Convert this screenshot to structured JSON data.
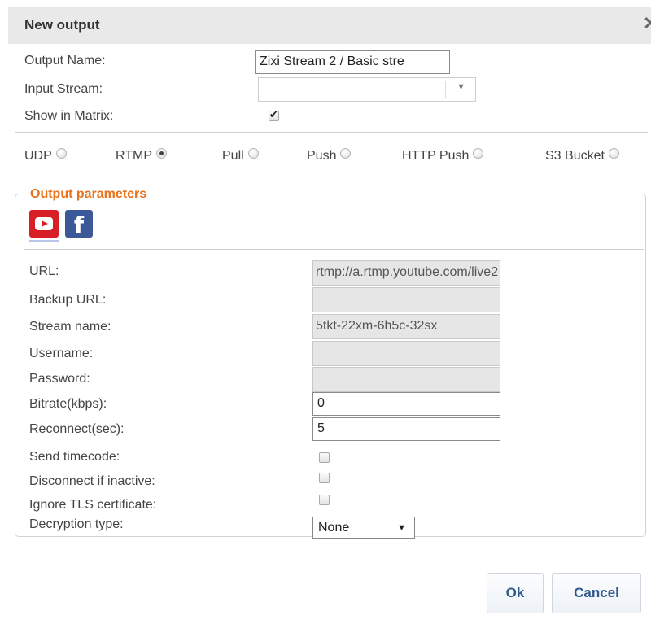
{
  "dialog": {
    "title": "New output"
  },
  "form": {
    "output_name_label": "Output Name:",
    "output_name_value": "Zixi Stream 2 / Basic stre",
    "input_stream_label": "Input Stream:",
    "input_stream_value": "",
    "show_in_matrix_label": "Show in Matrix:",
    "show_in_matrix_checked": true
  },
  "protocols": [
    {
      "label": "UDP",
      "checked": false
    },
    {
      "label": "RTMP",
      "checked": true
    },
    {
      "label": "Pull",
      "checked": false
    },
    {
      "label": "Push",
      "checked": false
    },
    {
      "label": "HTTP Push",
      "checked": false
    },
    {
      "label": "S3 Bucket",
      "checked": false
    }
  ],
  "params": {
    "legend": "Output parameters",
    "icons": [
      "youtube-icon",
      "facebook-icon"
    ],
    "url_label": "URL:",
    "url_value": "rtmp://a.rtmp.youtube.com/live2",
    "backup_url_label": "Backup URL:",
    "backup_url_value": "",
    "stream_name_label": "Stream name:",
    "stream_name_value": "5tkt-22xm-6h5c-32sx",
    "username_label": "Username:",
    "username_value": "",
    "password_label": "Password:",
    "password_value": "",
    "bitrate_label": "Bitrate(kbps):",
    "bitrate_value": "0",
    "reconnect_label": "Reconnect(sec):",
    "reconnect_value": "5",
    "send_timecode_label": "Send timecode:",
    "disconnect_label": "Disconnect if inactive:",
    "ignore_tls_label": "Ignore TLS certificate:",
    "decryption_label": "Decryption type:",
    "decryption_value": "None"
  },
  "footer": {
    "ok_label": "Ok",
    "cancel_label": "Cancel"
  },
  "colors": {
    "legend": "#e8711c",
    "button_text": "#2f5a8a",
    "youtube": "#d91f26",
    "facebook": "#3b5998"
  }
}
